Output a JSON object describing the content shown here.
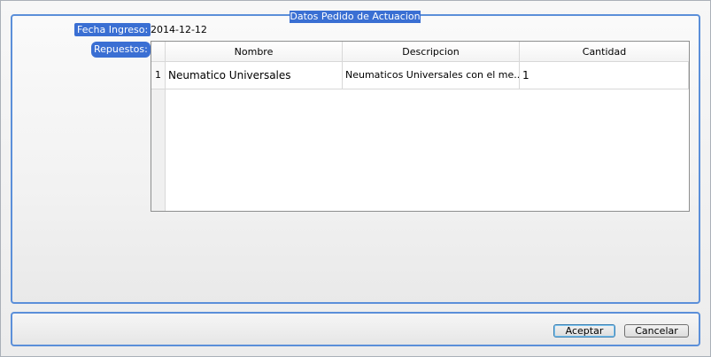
{
  "group": {
    "title": "Datos Pedido de Actuacion"
  },
  "fields": {
    "fecha_label": "Fecha Ingreso:",
    "fecha_value": "2014-12-12",
    "repuestos_label": "Repuestos:"
  },
  "table": {
    "columns": [
      "Nombre",
      "Descripcion",
      "Cantidad"
    ],
    "rows": [
      {
        "num": "1",
        "nombre": "Neumatico Universales",
        "descripcion": "Neumaticos Universales con el me...",
        "cantidad": "1"
      }
    ]
  },
  "buttons": {
    "aceptar": "Aceptar",
    "cancelar": "Cancelar"
  },
  "colors": {
    "accent": "#3a6fd3",
    "border": "#5b8fd9"
  }
}
